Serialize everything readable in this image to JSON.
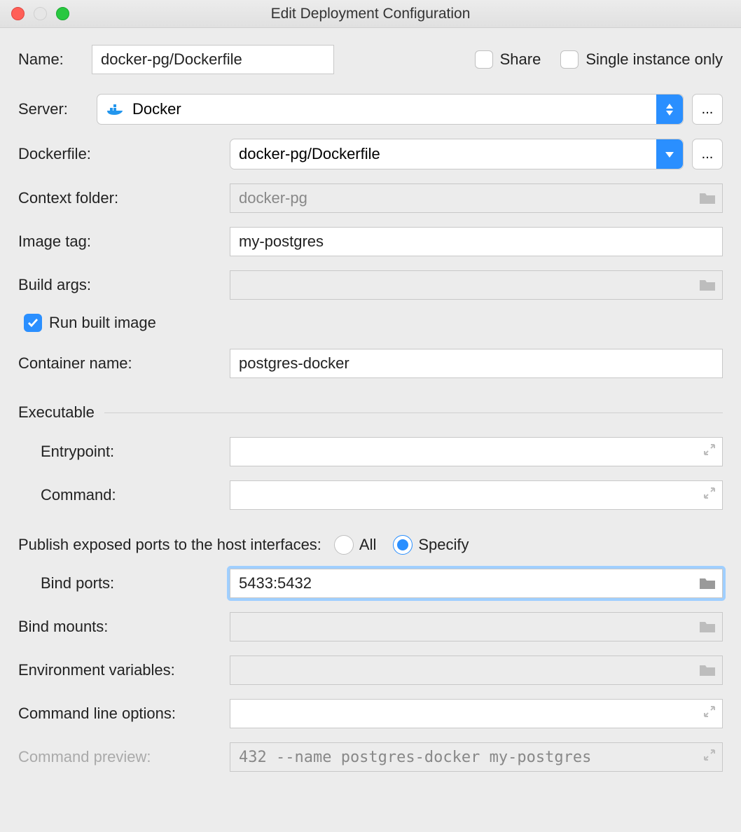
{
  "window": {
    "title": "Edit Deployment Configuration"
  },
  "labels": {
    "name": "Name:",
    "share": "Share",
    "single_instance": "Single instance only",
    "server": "Server:",
    "dockerfile": "Dockerfile:",
    "context_folder": "Context folder:",
    "image_tag": "Image tag:",
    "build_args": "Build args:",
    "run_built_image": "Run built image",
    "container_name": "Container name:",
    "executable": "Executable",
    "entrypoint": "Entrypoint:",
    "command": "Command:",
    "publish_ports": "Publish exposed ports to the host interfaces:",
    "radio_all": "All",
    "radio_specify": "Specify",
    "bind_ports": "Bind ports:",
    "bind_mounts": "Bind mounts:",
    "env_vars": "Environment variables:",
    "cmd_line_options": "Command line options:",
    "cmd_preview": "Command preview:",
    "more": "...",
    "more2": "..."
  },
  "values": {
    "name": "docker-pg/Dockerfile",
    "server": "Docker",
    "dockerfile": "docker-pg/Dockerfile",
    "context_folder": "docker-pg",
    "image_tag": "my-postgres",
    "build_args": "",
    "container_name": "postgres-docker",
    "entrypoint": "",
    "command": "",
    "bind_ports": "5433:5432",
    "bind_mounts": "",
    "env_vars": "",
    "cmd_line_options": "",
    "cmd_preview": "432 --name postgres-docker my-postgres"
  },
  "state": {
    "share_checked": false,
    "single_instance_checked": false,
    "run_built_image_checked": true,
    "publish_mode": "specify"
  }
}
